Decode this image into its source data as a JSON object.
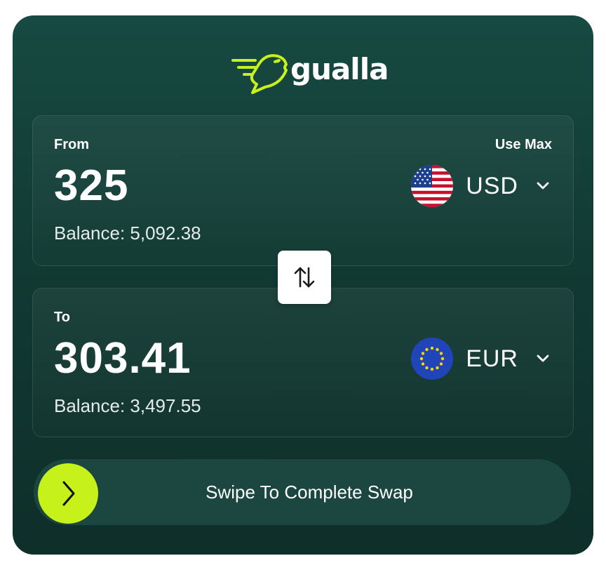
{
  "brand": {
    "name": "gualla",
    "logo_icon": "bird-logo-icon",
    "accent": "#c6f11a"
  },
  "from": {
    "label": "From",
    "use_max_label": "Use Max",
    "amount": "325",
    "balance": "Balance: 5,092.38",
    "currency": {
      "code": "USD",
      "flag": "us-flag-icon"
    }
  },
  "swap_icon": "swap-arrows-icon",
  "to": {
    "label": "To",
    "amount": "303.41",
    "balance": "Balance: 3,497.55",
    "currency": {
      "code": "EUR",
      "flag": "eu-flag-icon"
    }
  },
  "swipe": {
    "label": "Swipe To Complete Swap",
    "knob_icon": "chevron-right-icon"
  },
  "colors": {
    "card_bg": "#143f38",
    "swipe_bg": "#1c4740",
    "knob": "#c6f11a"
  }
}
